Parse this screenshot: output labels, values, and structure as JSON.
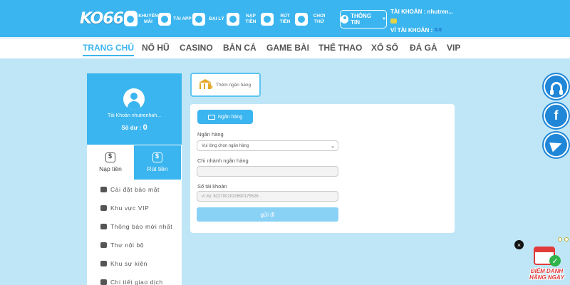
{
  "brand": {
    "logo_text": "KO66"
  },
  "topnav": {
    "items": [
      {
        "label": "KHUYẾN MÃI",
        "icon": "gift-icon"
      },
      {
        "label": "TẢI APP",
        "icon": "download-app-icon"
      },
      {
        "label": "ĐẠI LÝ",
        "icon": "agent-icon"
      },
      {
        "label": "NẠP TIỀN",
        "icon": "deposit-icon"
      },
      {
        "label": "RÚT TIỀN",
        "icon": "withdraw-icon"
      },
      {
        "label": "CHƠI THỬ",
        "icon": "trial-play-icon"
      }
    ],
    "info_button": "THÔNG TIN",
    "account_label": "TÀI KHOẢN : nhutren...",
    "wallet_label": "VÍ TÀI KHOẢN :",
    "wallet_value": "0.0"
  },
  "gamenav": {
    "items": [
      "TRANG CHỦ",
      "NỔ HŨ",
      "CASINO",
      "BẮN CÁ",
      "GAME BÀI",
      "THỂ THAO",
      "XỔ SỐ",
      "ĐÁ GÀ",
      "VIP"
    ],
    "active": "TRANG CHỦ"
  },
  "sidebar": {
    "account_name": "Tài Khoản nhutrenhah...",
    "balance_label": "Số dư :",
    "balance_value": "0",
    "tabs": [
      {
        "label": "Nạp tiền",
        "icon": "deposit-icon"
      },
      {
        "label": "Rút tiền",
        "icon": "withdraw-icon",
        "active": true
      }
    ],
    "menu": [
      {
        "label": "Cài đặt bảo mật",
        "icon": "user-lock-icon"
      },
      {
        "label": "Khu vực VIP",
        "icon": "crown-icon"
      },
      {
        "label": "Thông báo mới nhất",
        "icon": "megaphone-icon"
      },
      {
        "label": "Thư nội bộ",
        "icon": "mail-icon"
      },
      {
        "label": "Khu sự kiện",
        "icon": "trophy-icon"
      },
      {
        "label": "Chi tiết giao dịch",
        "icon": "receipt-icon"
      }
    ]
  },
  "main": {
    "add_bank_label": "Thêm ngân hàng",
    "bank_tab_label": "Ngân hàng",
    "bank_field": {
      "label": "Ngân hàng",
      "value": "Vui lòng chọn ngân hàng"
    },
    "branch_field": {
      "label": "Chi nhánh ngân hàng",
      "value": ""
    },
    "account_field": {
      "label": "Số tài khoản",
      "placeholder": "ví dụ:  6227002020690175526"
    },
    "submit_label": "gửi đi"
  },
  "floating": {
    "support": "headset-icon",
    "facebook": "f",
    "telegram": "telegram-icon",
    "close": "×",
    "checkin_label_1": "ĐIỂM DANH",
    "checkin_label_2": "HẰNG NGÀY"
  },
  "colors": {
    "primary": "#3bb5ef",
    "background": "#bfe6f7",
    "float_blue": "#1f86d8",
    "accent_red": "#e23b3b"
  }
}
